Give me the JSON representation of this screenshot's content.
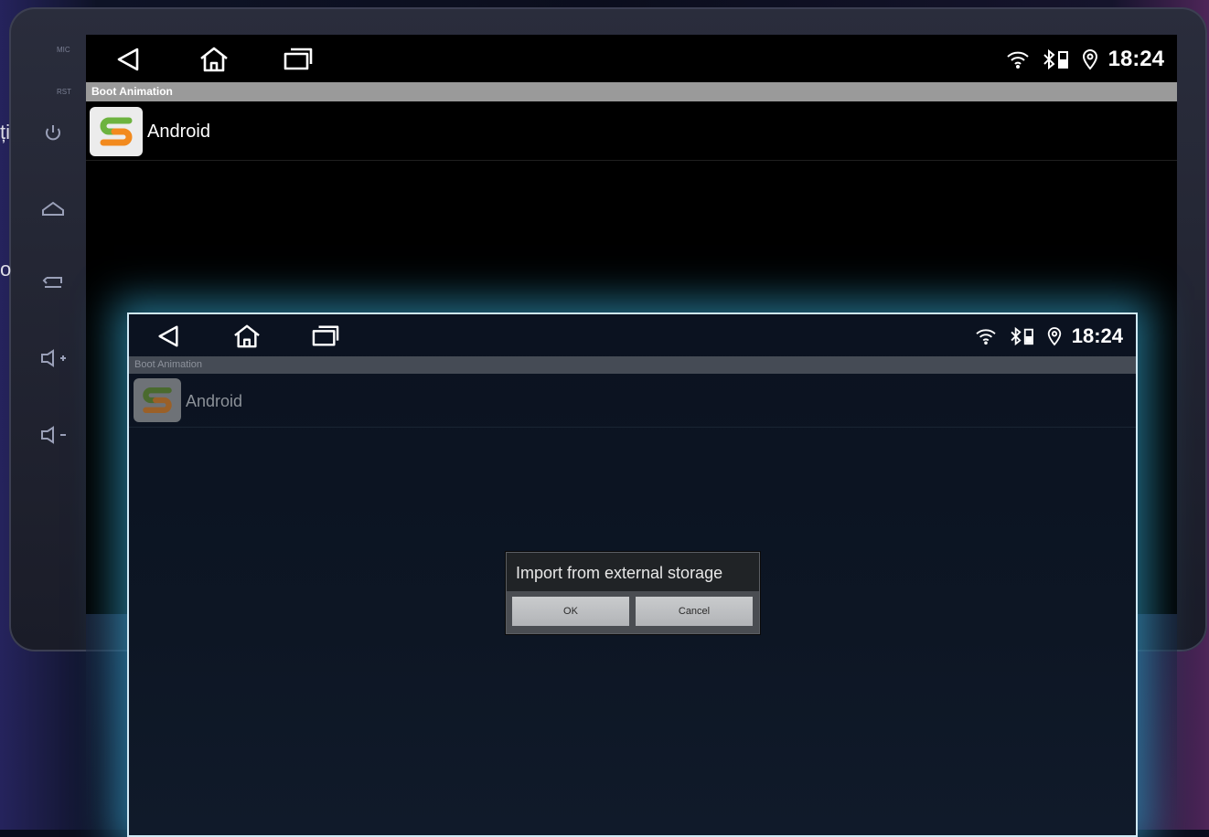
{
  "side_text": {
    "top": "ți",
    "middle": "o"
  },
  "hardware_buttons": [
    {
      "name": "mic",
      "label": "MIC"
    },
    {
      "name": "rst",
      "label": "RST"
    }
  ],
  "device_screen": {
    "status": {
      "time": "18:24"
    },
    "title": "Boot Animation",
    "list": [
      {
        "label": "Android"
      }
    ]
  },
  "overlay_screen": {
    "status": {
      "time": "18:24"
    },
    "title": "Boot Animation",
    "list": [
      {
        "label": "Android"
      }
    ],
    "dialog": {
      "title": "Import from external storage",
      "ok_label": "OK",
      "cancel_label": "Cancel"
    }
  },
  "colors": {
    "accent_glow": "#3cbeeb",
    "logo_green": "#6db33f",
    "logo_orange": "#f28a1e"
  }
}
